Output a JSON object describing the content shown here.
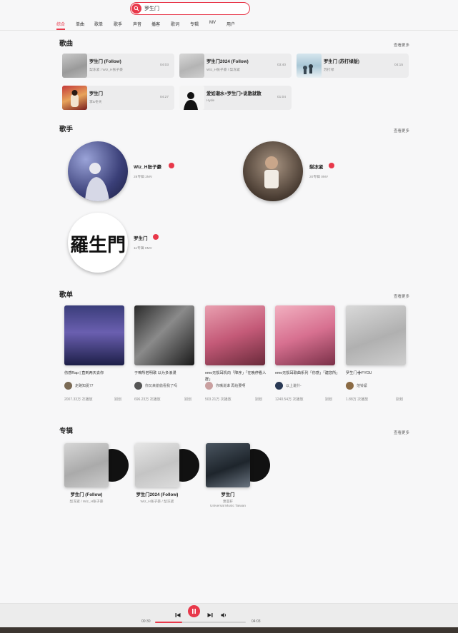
{
  "search": {
    "value": "罗生门"
  },
  "tabs": [
    "综合",
    "单曲",
    "歌单",
    "歌手",
    "声音",
    "播客",
    "歌词",
    "专辑",
    "MV",
    "用户"
  ],
  "active_tab": 0,
  "sections": {
    "songs": {
      "title": "歌曲",
      "more": "查看更多"
    },
    "artists": {
      "title": "歌手",
      "more": "查看更多"
    },
    "playlists": {
      "title": "歌单",
      "more": "查看更多"
    },
    "albums": {
      "title": "专辑",
      "more": "查看更多"
    }
  },
  "songs": [
    {
      "name": "罗生门 (Follow)",
      "artist": "梨冻紧 / Wiz_H张子豪",
      "duration": "04:03"
    },
    {
      "name": "罗生门2024 (Follow)",
      "artist": "Wiz_H张子豪 / 梨冻紧",
      "duration": "03:40"
    },
    {
      "name": "罗生门 (苏打绿版)",
      "artist": "苏打绿",
      "duration": "04:15"
    },
    {
      "name": "罗生门",
      "artist": "李&冬天",
      "duration": "04:27"
    },
    {
      "name": "爱如潮水+罗生门+说散就散",
      "artist": "Hyde",
      "duration": "01:04"
    }
  ],
  "artists": [
    {
      "name": "Wiz_H张子豪",
      "info": "28专辑  2MV"
    },
    {
      "name": "梨冻紧",
      "info": "20专辑  0MV"
    },
    {
      "name": "罗生门",
      "info": "11专辑  0MV",
      "logo_text": "羅生門"
    }
  ],
  "playlists": [
    {
      "name": "伤感Rap | 直到两天去你",
      "creator": "走路知夏77",
      "plays": "2007.33万 次播放",
      "action": "别划"
    },
    {
      "name": "于嘛所若明歌 以为多浪漫",
      "creator": "你又来偷偷看我了吗",
      "plays": "696.23万 次播放",
      "action": "别划"
    },
    {
      "name": "emo无损耳机向「降序」「在晚停看人群」",
      "creator": "你嘴说谁 再给要啊",
      "plays": "503.21万 次播放",
      "action": "别划"
    },
    {
      "name": "emo无损耳歌曲系列「伤感」「建您所」",
      "creator": "以上说什-",
      "plays": "1240.54万 次播放",
      "action": "别划"
    },
    {
      "name": "罗生门➕FYOU",
      "creator": "范铃紧",
      "plays": "1.88万 次播放",
      "action": "别划"
    }
  ],
  "albums": [
    {
      "name": "罗生门 (Follow)",
      "artist": "梨冻紧 / Wiz_H张子豪",
      "label": ""
    },
    {
      "name": "罗生门2024 (Follow)",
      "artist": "Wiz_H张子豪 / 梨冻紧",
      "label": ""
    },
    {
      "name": "罗生门",
      "artist": "萧亚轩",
      "label": "Universal Music Taiwan"
    }
  ],
  "player": {
    "current": "00:30",
    "total": "04:03",
    "progress": 0.3
  },
  "colors": {
    "accent": "#e8384a"
  }
}
